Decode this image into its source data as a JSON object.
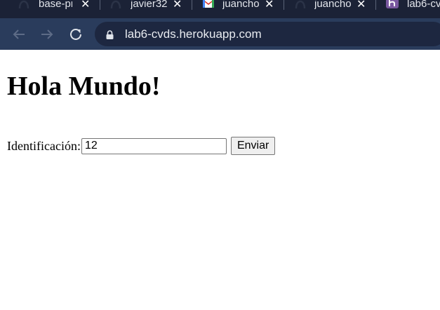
{
  "browser": {
    "tabs": [
      {
        "label": "base-pr",
        "icon": "github-icon"
      },
      {
        "label": "javier32",
        "icon": "github-icon"
      },
      {
        "label": "juancho",
        "icon": "gmail-icon"
      },
      {
        "label": "juancho",
        "icon": "github-icon"
      },
      {
        "label": "lab6-cv",
        "icon": "heroku-icon"
      }
    ],
    "tab_close_glyph": "✕",
    "url": "lab6-cvds.herokuapp.com",
    "colors": {
      "tab_strip": "#1b2236",
      "toolbar": "#2a3c5c",
      "omnibox": "#1d2740",
      "heroku": "#79589f"
    }
  },
  "page": {
    "heading": "Hola Mundo!",
    "form": {
      "label": "Identificación:",
      "input_value": "12",
      "submit_label": "Enviar"
    }
  }
}
